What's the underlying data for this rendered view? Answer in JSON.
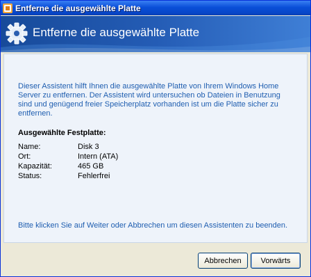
{
  "window": {
    "title": "Entferne die ausgewählte Platte"
  },
  "header": {
    "title": "Entferne die ausgewählte Platte",
    "icon": "gear-icon"
  },
  "main": {
    "intro": "Dieser Assistent hilft Ihnen die ausgewählte Platte von Ihrem Windows Home Server zu entfernen. Der Assistent wird untersuchen ob Dateien in Benutzung sind und genügend freier Speicherplatz vorhanden ist um die Platte sicher zu entfernen.",
    "section_title": "Ausgewählte Festplatte:",
    "info": [
      {
        "label": "Name:",
        "value": "Disk 3"
      },
      {
        "label": "Ort:",
        "value": "Intern (ATA)"
      },
      {
        "label": "Kapazität:",
        "value": "465 GB"
      },
      {
        "label": "Status:",
        "value": "Fehlerfrei"
      }
    ],
    "footer_text": "Bitte klicken Sie auf Weiter oder Abbrechen um diesen Assistenten zu beenden."
  },
  "buttons": {
    "cancel": "Abbrechen",
    "next": "Vorwärts"
  },
  "colors": {
    "accent_text": "#1f5eb0",
    "header_blue": "#245cb5"
  }
}
